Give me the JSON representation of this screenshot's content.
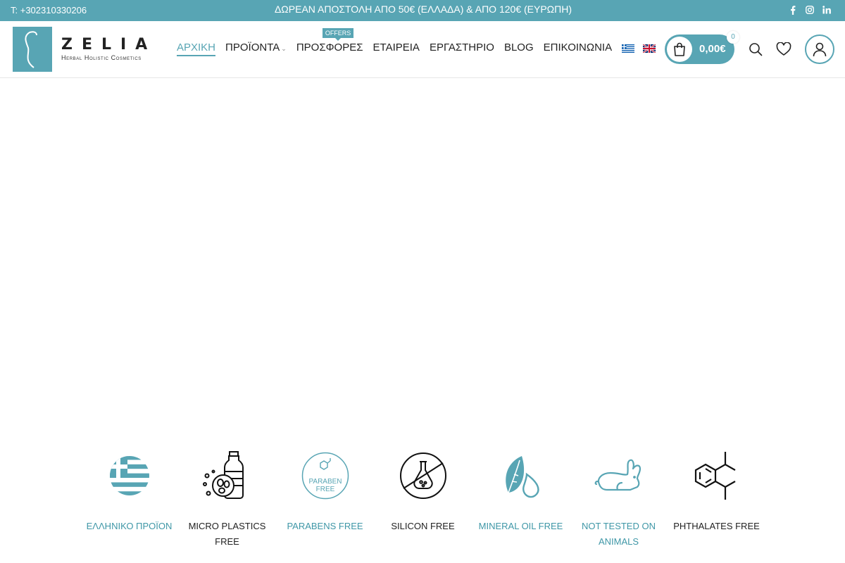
{
  "topbar": {
    "phone": "T: +302310330206",
    "promo": "ΔΩΡΕΑΝ ΑΠΟΣΤΟΛΗ ΑΠΟ 50€ (ΕΛΛΑΔΑ) & ΑΠΟ 120€ (ΕΥΡΩΠΗ)",
    "social_icons": [
      "facebook-icon",
      "instagram-icon",
      "linkedin-icon"
    ]
  },
  "logo": {
    "word": "ZELIA",
    "tagline": "Herbal Holistic Cosmetics"
  },
  "nav": {
    "items": [
      {
        "label": "ΑΡΧΙΚΗ",
        "active": true
      },
      {
        "label": "ΠΡΟΪΟΝΤΑ",
        "has_dropdown": true
      },
      {
        "label": "ΠΡΟΣΦΟΡΕΣ",
        "badge": "OFFERS"
      },
      {
        "label": "ΕΤΑΙΡΕΙΑ"
      },
      {
        "label": "ΕΡΓΑΣΤΗΡΙΟ"
      },
      {
        "label": "BLOG"
      },
      {
        "label": "ΕΠΙΚΟΙΝΩΝΙΑ"
      }
    ],
    "languages": [
      "greek-flag-icon",
      "uk-flag-icon"
    ]
  },
  "cart": {
    "total": "0,00€",
    "count": "0"
  },
  "features": [
    {
      "label": "ΕΛΛΗΝΙΚΟ ΠΡΟΪΟΝ",
      "icon": "greek-flag-circle-icon",
      "color": "teal"
    },
    {
      "label": "MICRO PLASTICS FREE",
      "icon": "microplastics-bottle-icon",
      "color": "dark"
    },
    {
      "label": "PARABENS FREE",
      "icon": "paraben-free-icon",
      "icon_text_1": "PARABEN",
      "icon_text_2": "FREE",
      "color": "teal"
    },
    {
      "label": "SILICON FREE",
      "icon": "silicon-free-flask-icon",
      "color": "dark"
    },
    {
      "label": "MINERAL OIL FREE",
      "icon": "leaf-drop-icon",
      "color": "teal"
    },
    {
      "label": "NOT TESTED ON ANIMALS",
      "icon": "rabbit-icon",
      "color": "teal"
    },
    {
      "label": "PHTHALATES FREE",
      "icon": "molecule-icon",
      "color": "dark"
    }
  ],
  "colors": {
    "accent": "#58a5b4",
    "text": "#222222"
  }
}
